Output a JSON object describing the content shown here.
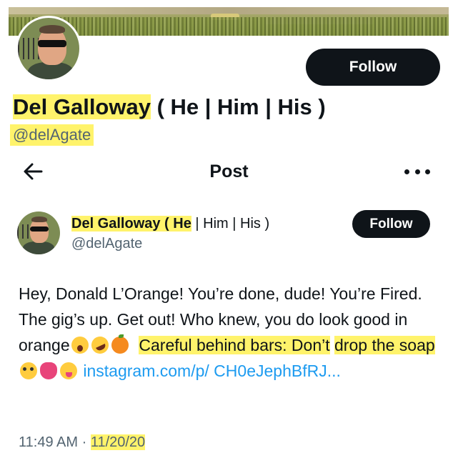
{
  "profile": {
    "follow_label": "Follow",
    "name": "Del Galloway",
    "pronouns": " ( He | Him | His )",
    "handle": "@delAgate"
  },
  "header": {
    "title": "Post"
  },
  "post": {
    "author_name": "Del Galloway",
    "author_pronouns_bold": " ( He",
    "author_pronouns_rest": " | Him | His )",
    "author_handle": "@delAgate",
    "follow_label": "Follow",
    "text_part1": "Hey, Donald L’Orange! You’re done, dude! You’re Fired. The gig’s up. Get out!  Who knew, you do look good in orange",
    "text_highlight1": "Careful behind bars: Don’t",
    "text_highlight2": "drop the soap",
    "link_text": "instagram.com/p/ CH0eJephBfRJ...",
    "time": "11:49 AM",
    "separator": " · ",
    "date": "11/20/20"
  },
  "icons": {
    "back": "arrow-left-icon",
    "more": "more-horizontal-icon",
    "emoji_1": "face-screaming-icon",
    "emoji_2": "rolling-laughing-icon",
    "emoji_3": "orange-fruit-icon",
    "emoji_4": "flushed-face-icon",
    "emoji_5": "tongue-icon",
    "emoji_6": "squinting-tongue-face-icon"
  },
  "colors": {
    "highlight": "#fff36b",
    "link": "#1d9bf0",
    "button_bg": "#0f1419",
    "secondary_text": "#536471"
  }
}
